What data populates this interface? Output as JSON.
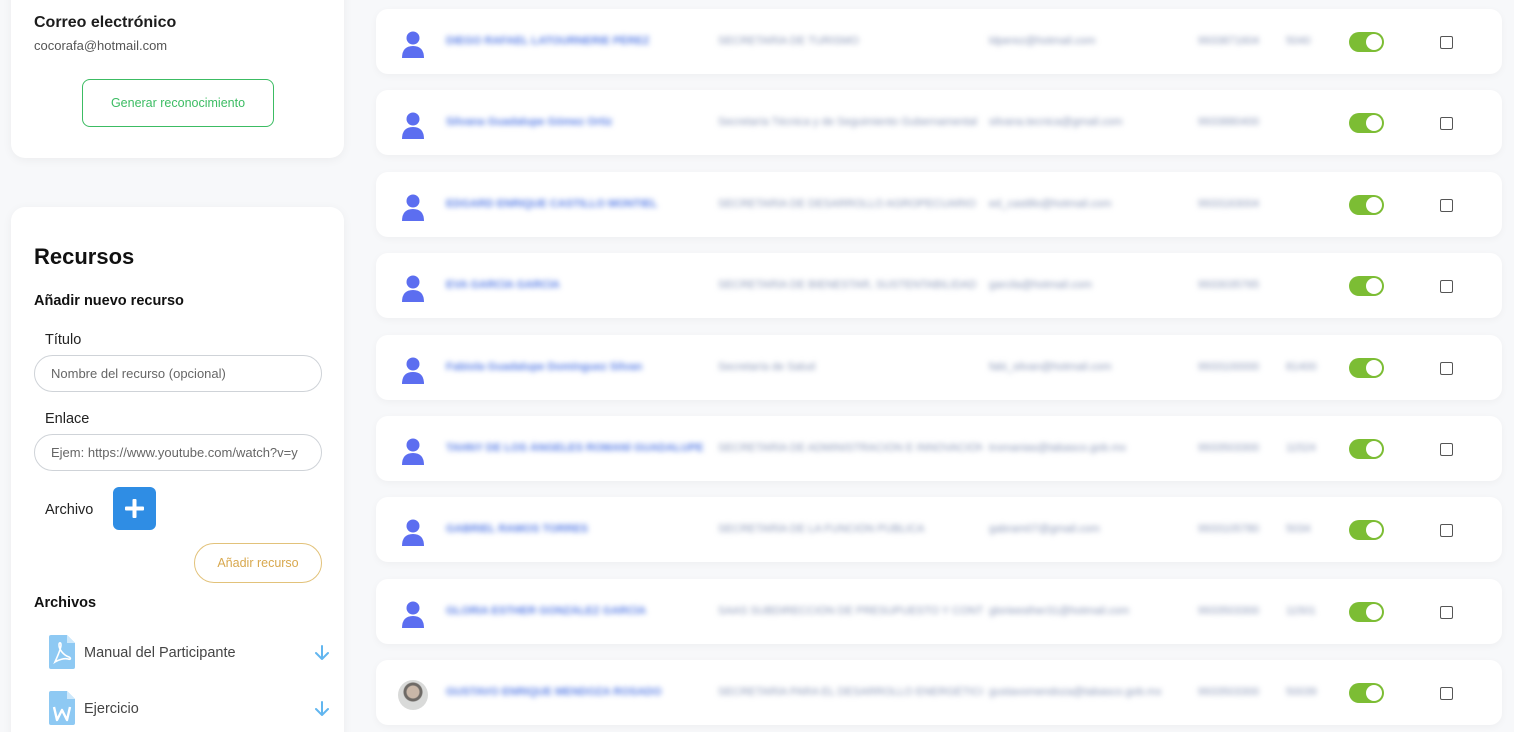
{
  "contact": {
    "email_label": "Correo electrónico",
    "email_value": "cocorafa@hotmail.com",
    "generate_button": "Generar reconocimiento"
  },
  "resources": {
    "title": "Recursos",
    "add_new": "Añadir nuevo recurso",
    "title_label": "Título",
    "title_placeholder": "Nombre del recurso (opcional)",
    "link_label": "Enlace",
    "link_placeholder": "Ejem: https://www.youtube.com/watch?v=y",
    "file_label": "Archivo",
    "add_button": "Añadir recurso",
    "files_heading": "Archivos",
    "files": [
      {
        "name": "Manual del Participante",
        "icon": "pdf-file-icon"
      },
      {
        "name": "Ejercicio",
        "icon": "word-file-icon"
      }
    ]
  },
  "participants": [
    {
      "name": "DIEGO RAFAEL LATOURNERIE PÉREZ",
      "department": "SECRETARÍA DE TURISMO",
      "email": "ldperez@hotmail.com",
      "phone": "9933871604",
      "ext": "5040",
      "active": true
    },
    {
      "name": "Silvana Guadalupe Gómez Ortiz",
      "department": "Secretaría Técnica y de Seguimiento Gubernamental",
      "email": "silvana.tecnica@gmail.com",
      "phone": "9933880400",
      "ext": "",
      "active": true
    },
    {
      "name": "EDGARD ENRIQUE CASTILLO MONTIEL",
      "department": "SECRETARÍA DE DESARROLLO AGROPECUARIO",
      "email": "ed_castillo@hotmail.com",
      "phone": "9933163004",
      "ext": "",
      "active": true
    },
    {
      "name": "EVA GARCÍA GARCÍA",
      "department": "SECRETARÍA DE BIENESTAR, SUSTENTABILIDAD",
      "email": "garcila@hotmail.com",
      "phone": "9933035765",
      "ext": "",
      "active": true
    },
    {
      "name": "Fabiola Guadalupe Domínguez Silvan",
      "department": "Secretaría de Salud",
      "email": "fabi_silvan@hotmail.com",
      "phone": "9933100000",
      "ext": "81400",
      "active": true
    },
    {
      "name": "TAHNY DE LOS ÁNGELES ROMANÍ GUADALUPE",
      "department": "SECRETARÍA DE ADMINISTRACIÓN E INNOVACIÓN",
      "email": "tromanias@tabasco.gob.mx",
      "phone": "9933503300",
      "ext": "11524",
      "active": true
    },
    {
      "name": "GABRIEL RAMOS TORRES",
      "department": "SECRETARÍA DE LA FUNCIÓN PÚBLICA",
      "email": "gabram07@gmail.com",
      "phone": "9933105780",
      "ext": "5034",
      "active": true
    },
    {
      "name": "GLORIA ESTHER GONZÁLEZ GARCÍA",
      "department": "SAAS SUBDIRECCIÓN DE PRESUPUESTO Y CONTROL",
      "email": "glorieesther31@hotmail.com",
      "phone": "9933503300",
      "ext": "11501",
      "active": true
    },
    {
      "name": "GUSTAVO ENRIQUE MENDOZA ROSADO",
      "department": "SECRETARÍA PARA EL DESARROLLO ENERGÉTICO",
      "email": "gustavomendoza@tabasco.gob.mx",
      "phone": "9933503300",
      "ext": "50039",
      "active": true
    }
  ]
}
